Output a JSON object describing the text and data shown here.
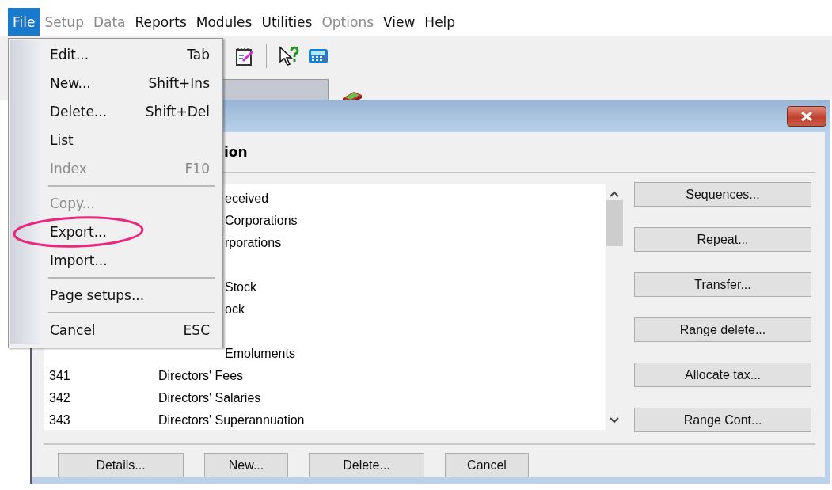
{
  "menubar": [
    {
      "label": "File",
      "selected": true,
      "disabled": false
    },
    {
      "label": "Setup",
      "selected": false,
      "disabled": true
    },
    {
      "label": "Data",
      "selected": false,
      "disabled": true
    },
    {
      "label": "Reports",
      "selected": false,
      "disabled": false
    },
    {
      "label": "Modules",
      "selected": false,
      "disabled": false
    },
    {
      "label": "Utilities",
      "selected": false,
      "disabled": false
    },
    {
      "label": "Options",
      "selected": false,
      "disabled": true
    },
    {
      "label": "View",
      "selected": false,
      "disabled": false
    },
    {
      "label": "Help",
      "selected": false,
      "disabled": false
    }
  ],
  "file_menu": [
    {
      "kind": "item",
      "label": "Edit...",
      "shortcut": "Tab",
      "disabled": false
    },
    {
      "kind": "item",
      "label": "New...",
      "shortcut": "Shift+Ins",
      "disabled": false
    },
    {
      "kind": "item",
      "label": "Delete...",
      "shortcut": "Shift+Del",
      "disabled": false
    },
    {
      "kind": "item",
      "label": "List",
      "disabled": false
    },
    {
      "kind": "item",
      "label": "Index",
      "shortcut": "F10",
      "disabled": true
    },
    {
      "kind": "separator"
    },
    {
      "kind": "item",
      "label": "Copy...",
      "disabled": true
    },
    {
      "kind": "item",
      "label": "Export...",
      "disabled": false,
      "circled": true
    },
    {
      "kind": "item",
      "label": "Import...",
      "disabled": false
    },
    {
      "kind": "separator"
    },
    {
      "kind": "item",
      "label": "Page setups...",
      "disabled": false
    },
    {
      "kind": "separator"
    },
    {
      "kind": "item",
      "label": "Cancel",
      "shortcut": "ESC",
      "disabled": false
    }
  ],
  "dialog": {
    "heading": "ion",
    "rows": [
      {
        "description": "eceived",
        "partial": true
      },
      {
        "description": "Corporations",
        "partial": true
      },
      {
        "description": "rporations",
        "partial": true
      },
      {},
      {
        "description": "Stock",
        "partial": true
      },
      {
        "description": "ock",
        "partial": true
      },
      {},
      {
        "description": "Emoluments",
        "partial": true
      },
      {
        "code": "341",
        "description": "Directors' Fees",
        "partial": false
      },
      {
        "code": "342",
        "description": "Directors' Salaries",
        "partial": false
      },
      {
        "code": "343",
        "description": "Directors' Superannuation",
        "partial": false
      }
    ],
    "side_buttons": [
      "Sequences...",
      "Repeat...",
      "Transfer...",
      "Range delete...",
      "Allocate tax...",
      "Range Cont..."
    ],
    "bottom_buttons": [
      "Details...",
      "New...",
      "Delete...",
      "Cancel"
    ]
  }
}
